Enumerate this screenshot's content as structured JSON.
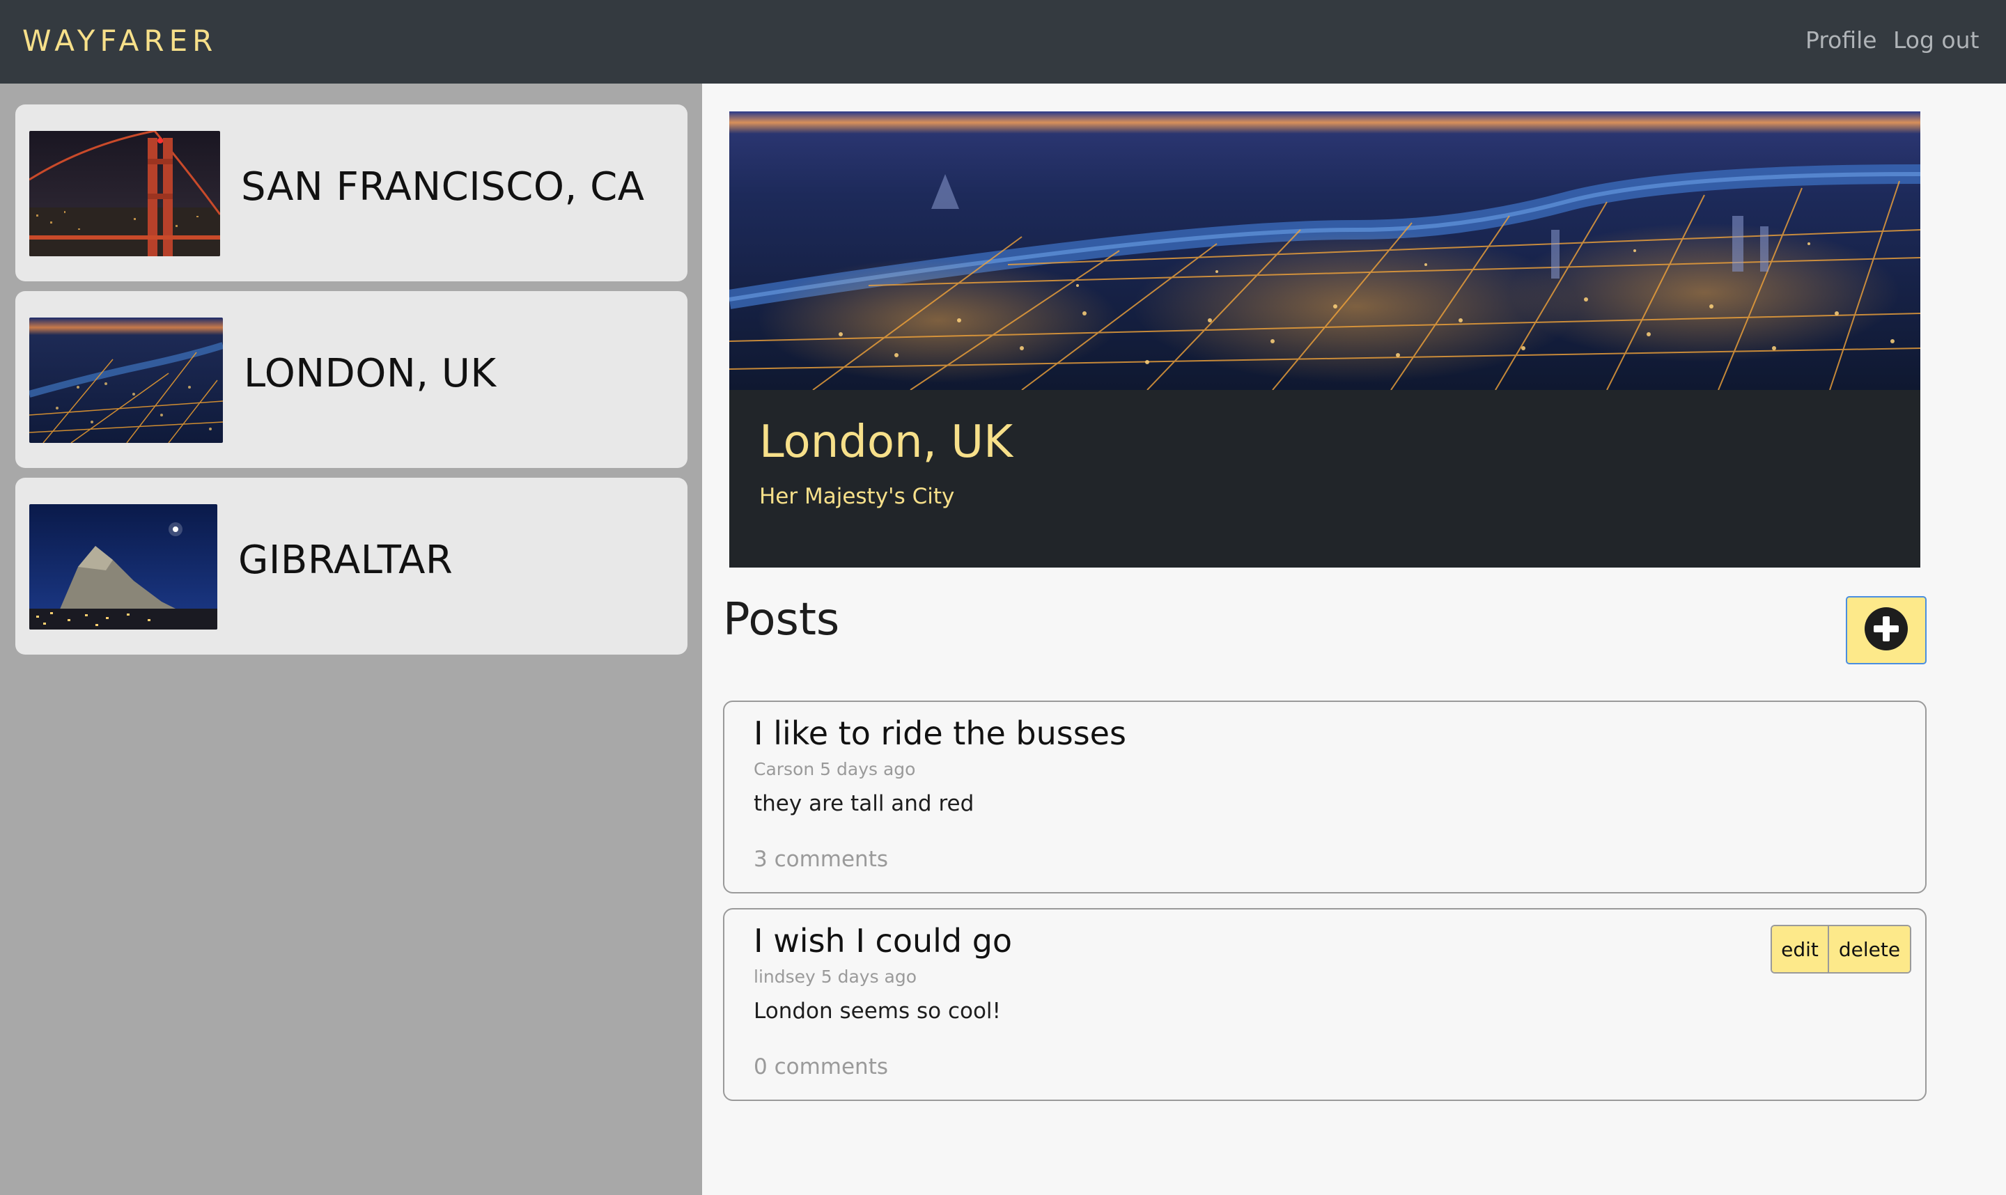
{
  "navbar": {
    "brand": "WAYFARER",
    "links": [
      "Profile",
      "Log out"
    ]
  },
  "sidebar": {
    "cities": [
      {
        "name": "SAN FRANCISCO, CA",
        "image": "golden-gate-bridge-night-photo"
      },
      {
        "name": "LONDON, UK",
        "image": "london-aerial-night-photo"
      },
      {
        "name": "GIBRALTAR",
        "image": "rock-of-gibraltar-night-photo"
      }
    ]
  },
  "hero": {
    "title": "London, UK",
    "subtitle": "Her Majesty's City",
    "image": "london-aerial-night-panorama"
  },
  "posts": {
    "heading": "Posts",
    "add_icon": "plus-circle-icon",
    "items": [
      {
        "title": "I like to ride the busses",
        "meta": "Carson 5 days ago",
        "body": "they are tall and red",
        "comments": "3 comments"
      },
      {
        "title": "I wish I could go",
        "meta": "lindsey 5 days ago",
        "body": "London seems so cool!",
        "comments": "0 comments",
        "actions": [
          "edit",
          "delete"
        ]
      }
    ]
  },
  "colors": {
    "navbar": "#343a40",
    "accent_yellow": "#f7e08a",
    "button_yellow": "#fde98a",
    "sidebar": "#a8a8a8",
    "card": "#e8e8e8",
    "hero_dark": "#212529"
  }
}
